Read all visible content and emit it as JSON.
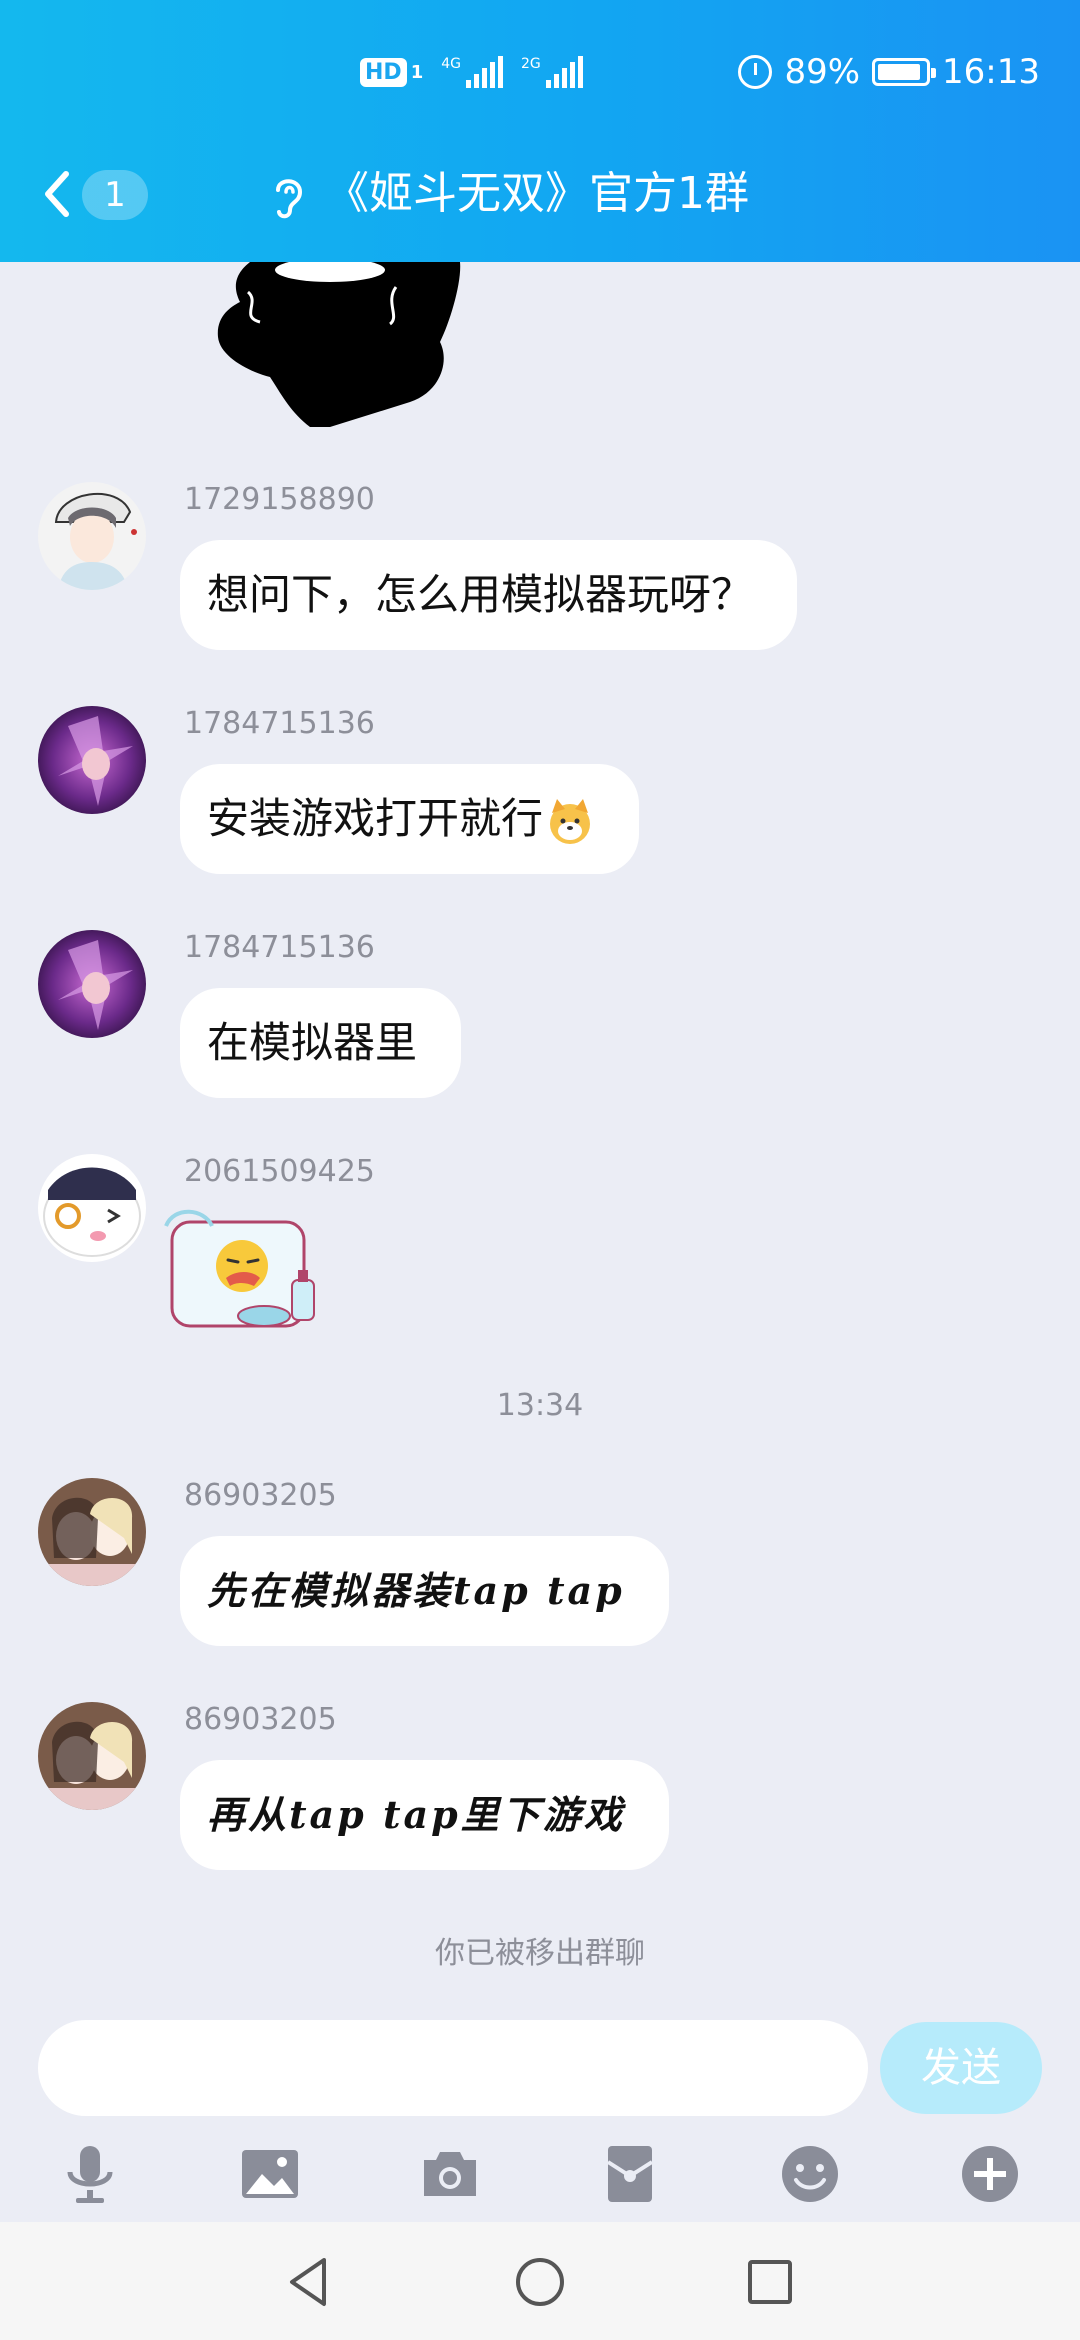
{
  "status_bar": {
    "hd": "HD",
    "sim1": "1",
    "net1": "4G",
    "net2": "2G",
    "battery": "89%",
    "time": "16:13"
  },
  "header": {
    "unread_count": "1",
    "title": "《姬斗无双》官方1群"
  },
  "messages": [
    {
      "sender": "1729158890",
      "text": "想问下，怎么用模拟器玩呀？"
    },
    {
      "sender": "1784715136",
      "text": "安装游戏打开就行"
    },
    {
      "sender": "1784715136",
      "text": "在模拟器里"
    },
    {
      "sender": "2061509425",
      "sticker": "sticker-drool-emoji"
    },
    {
      "sender": "86903205",
      "text": "先在模拟器装tap tap"
    },
    {
      "sender": "86903205",
      "text": "再从tap tap里下游戏"
    }
  ],
  "timestamp": "13:34",
  "system_note": "你已被移出群聊",
  "input": {
    "placeholder": "",
    "send_label": "发送"
  },
  "toolbar_icons": [
    "microphone-icon",
    "image-icon",
    "camera-icon",
    "red-packet-icon",
    "emoji-icon",
    "plus-icon"
  ],
  "colors": {
    "header": "#14b8ee",
    "background": "#ebedf5",
    "send_button": "#b6ebfb"
  }
}
